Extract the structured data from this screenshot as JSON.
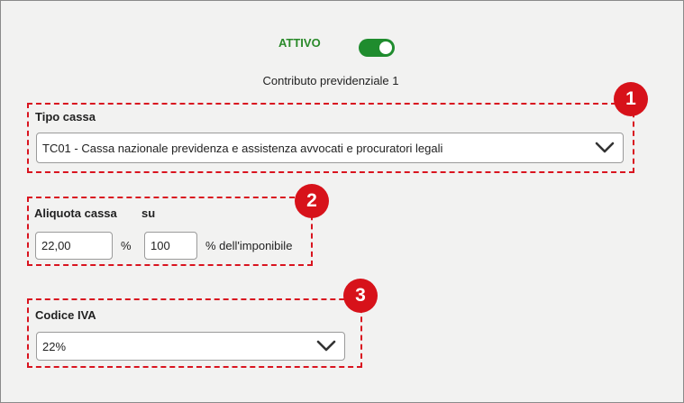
{
  "status": {
    "label": "ATTIVO",
    "active": true,
    "accent_color": "#1f8c2e"
  },
  "section_title": "Contributo previdenziale 1",
  "tipo_cassa": {
    "label": "Tipo cassa",
    "value": "TC01 - Cassa nazionale previdenza e assistenza avvocati e procuratori legali",
    "badge": "1"
  },
  "aliquota": {
    "label": "Aliquota cassa",
    "su_label": "su",
    "rate_value": "22,00",
    "percent_sign": "%",
    "base_value": "100",
    "base_suffix": "% dell'imponibile",
    "badge": "2"
  },
  "codice_iva": {
    "label": "Codice IVA",
    "value": "22%",
    "badge": "3"
  },
  "highlight_color": "#d9141f",
  "icons": {
    "dropdown": "chevron-down-icon"
  }
}
